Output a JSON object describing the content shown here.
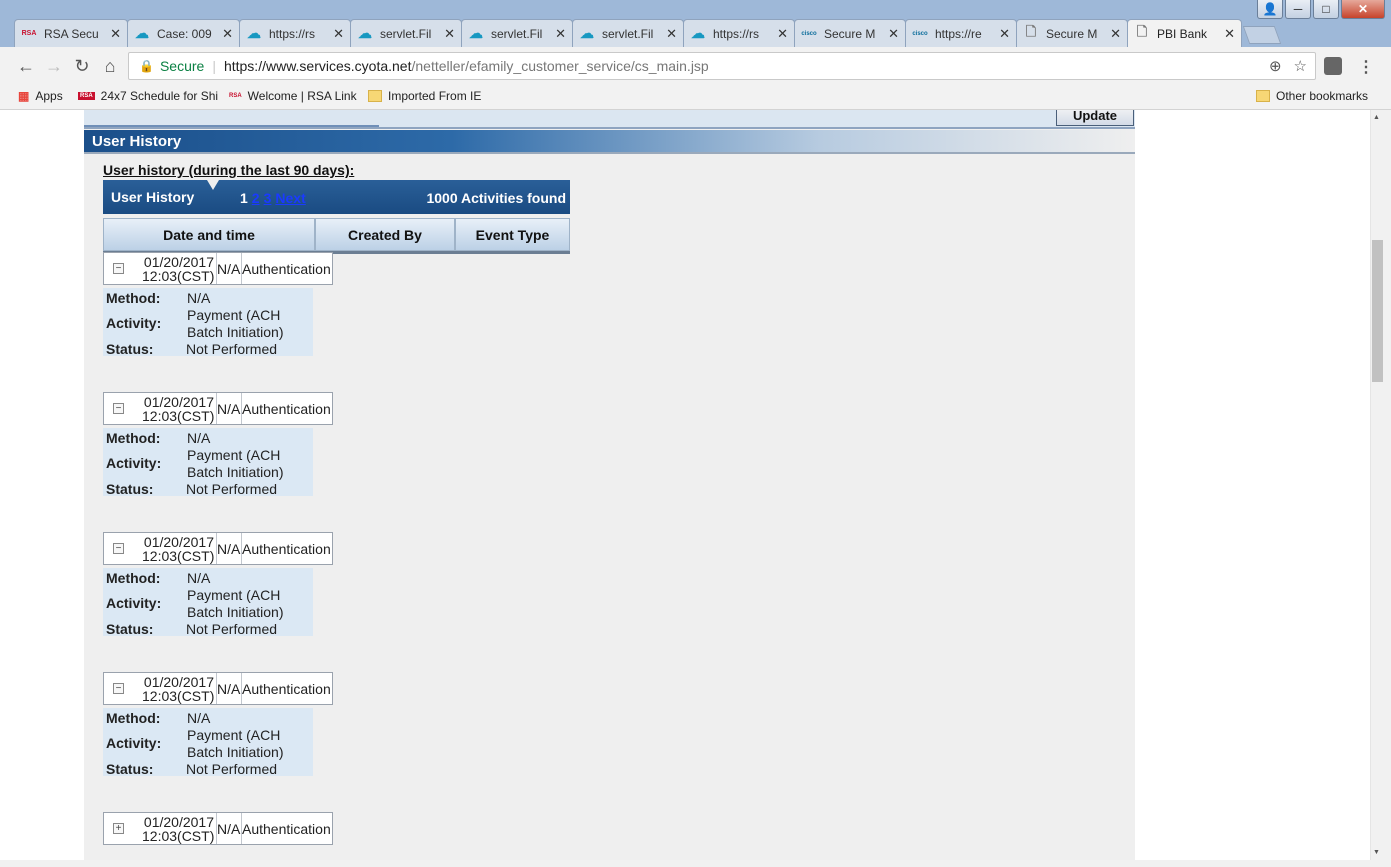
{
  "window_controls": {
    "user": "👤",
    "minimize": "─",
    "maximize": "□",
    "close": "✕"
  },
  "tabs": [
    {
      "title": "RSA Secu",
      "icon": "rsa-icon",
      "icon_text": "RSA",
      "active": false
    },
    {
      "title": "Case: 009",
      "icon": "salesforce-icon",
      "icon_text": "☁",
      "active": false
    },
    {
      "title": "https://rs",
      "icon": "salesforce-icon",
      "icon_text": "☁",
      "active": false
    },
    {
      "title": "servlet.Fil",
      "icon": "salesforce-icon",
      "icon_text": "☁",
      "active": false
    },
    {
      "title": "servlet.Fil",
      "icon": "salesforce-icon",
      "icon_text": "☁",
      "active": false
    },
    {
      "title": "servlet.Fil",
      "icon": "salesforce-icon",
      "icon_text": "☁",
      "active": false
    },
    {
      "title": "https://rs",
      "icon": "salesforce-icon",
      "icon_text": "☁",
      "active": false
    },
    {
      "title": "Secure M",
      "icon": "cisco-icon",
      "icon_text": "cisco",
      "active": false
    },
    {
      "title": "https://re",
      "icon": "cisco-icon",
      "icon_text": "cisco",
      "active": false
    },
    {
      "title": "Secure M",
      "icon": "document-icon",
      "icon_text": "🗋",
      "active": false
    },
    {
      "title": "PBI Bank",
      "icon": "document-icon",
      "icon_text": "🗋",
      "active": true
    }
  ],
  "tab_close": "✕",
  "nav": {
    "back": "←",
    "forward": "→",
    "reload": "↻",
    "home": "⌂"
  },
  "address": {
    "lock": "🔒",
    "secure_label": "Secure",
    "separator": "|",
    "url_host": "https://www.services.cyota.net",
    "url_path": "/netteller/efamily_customer_service/cs_main.jsp",
    "zoom_icon": "⊕",
    "star_icon": "☆"
  },
  "menu_icon": "⋮",
  "bookmarks": {
    "apps": {
      "label": "Apps",
      "icon": "▦"
    },
    "items": [
      {
        "label": "24x7 Schedule for Shi",
        "icon_text": "RSA"
      },
      {
        "label": "Welcome | RSA Link",
        "icon_text": "RSA"
      },
      {
        "label": "Imported From IE",
        "icon_text": ""
      }
    ],
    "other": "Other bookmarks"
  },
  "page": {
    "update_button": "Update",
    "section_title": "User History",
    "history_heading": "User history (during the last 90 days):",
    "table": {
      "title": "User History",
      "pages": {
        "current": "1",
        "links": [
          "2",
          "3",
          "Next"
        ]
      },
      "count": "1000 Activities found",
      "columns": [
        "Date and time",
        "Created By",
        "Event Type"
      ]
    },
    "entries": [
      {
        "toggle": "−",
        "date": "01/20/2017",
        "time": "12:03(CST)",
        "created_by": "N/A",
        "event": "Authentication",
        "expanded": true,
        "method_label": "Method:",
        "method": "N/A",
        "activity_label": "Activity:",
        "activity_1": "Payment (ACH",
        "activity_2": "Batch Initiation)",
        "status_label": "Status:",
        "status": "Not Performed"
      },
      {
        "toggle": "−",
        "date": "01/20/2017",
        "time": "12:03(CST)",
        "created_by": "N/A",
        "event": "Authentication",
        "expanded": true,
        "method_label": "Method:",
        "method": "N/A",
        "activity_label": "Activity:",
        "activity_1": "Payment (ACH",
        "activity_2": "Batch Initiation)",
        "status_label": "Status:",
        "status": "Not Performed"
      },
      {
        "toggle": "−",
        "date": "01/20/2017",
        "time": "12:03(CST)",
        "created_by": "N/A",
        "event": "Authentication",
        "expanded": true,
        "method_label": "Method:",
        "method": "N/A",
        "activity_label": "Activity:",
        "activity_1": "Payment (ACH",
        "activity_2": "Batch Initiation)",
        "status_label": "Status:",
        "status": "Not Performed"
      },
      {
        "toggle": "−",
        "date": "01/20/2017",
        "time": "12:03(CST)",
        "created_by": "N/A",
        "event": "Authentication",
        "expanded": true,
        "method_label": "Method:",
        "method": "N/A",
        "activity_label": "Activity:",
        "activity_1": "Payment (ACH",
        "activity_2": "Batch Initiation)",
        "status_label": "Status:",
        "status": "Not Performed"
      },
      {
        "toggle": "+",
        "date": "01/20/2017",
        "time": "12:03(CST)",
        "created_by": "N/A",
        "event": "Authentication",
        "expanded": false
      }
    ]
  }
}
